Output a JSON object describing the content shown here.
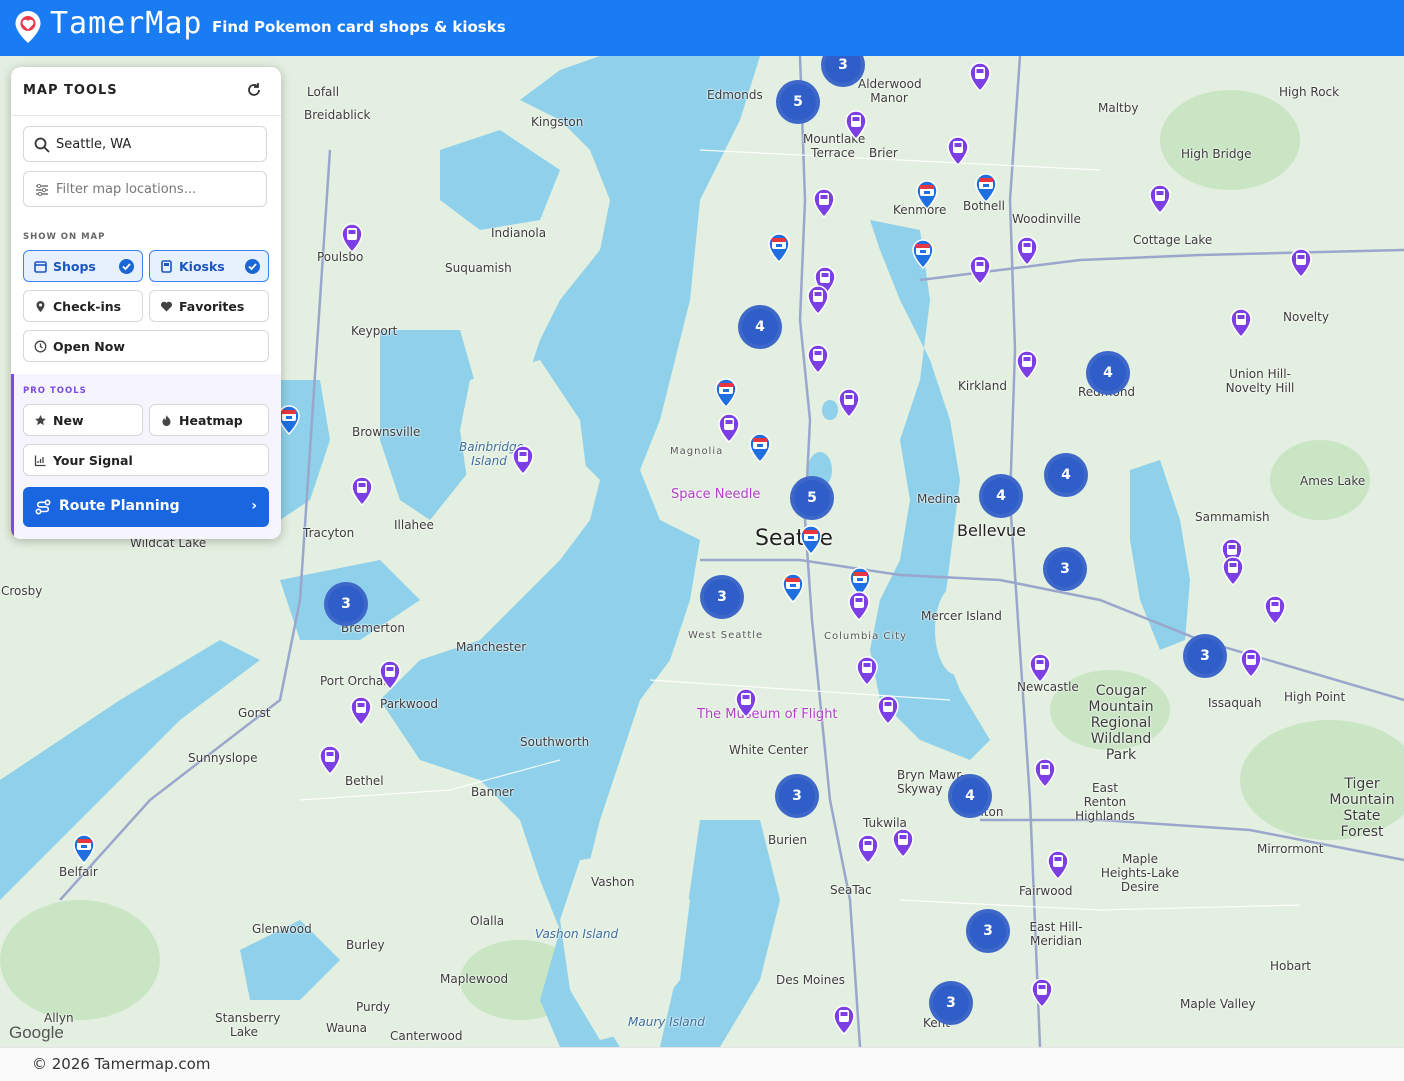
{
  "header": {
    "brand": "TamerMap",
    "tagline": "Find Pokemon card shops & kiosks"
  },
  "panel": {
    "title": "MAP TOOLS",
    "search": {
      "value": "Seattle, WA"
    },
    "filter": {
      "placeholder": "Filter map locations..."
    },
    "show_on_map_label": "SHOW ON MAP",
    "toggles": [
      {
        "label": "Shops",
        "active": true
      },
      {
        "label": "Kiosks",
        "active": true
      },
      {
        "label": "Check-ins",
        "active": false
      },
      {
        "label": "Favorites",
        "active": false
      },
      {
        "label": "Open Now",
        "active": false
      }
    ],
    "pro_tools_label": "PRO TOOLS",
    "pro_tools": [
      "New",
      "Heatmap",
      "Your Signal"
    ],
    "route_planning": "Route Planning"
  },
  "map": {
    "places": [
      {
        "t": "Lofall"
      },
      {
        "t": "Breidablick"
      },
      {
        "t": "Kingston"
      },
      {
        "t": "Edmonds"
      },
      {
        "t": "Alderwood Manor"
      },
      {
        "t": "Mountlake Terrace"
      },
      {
        "t": "Brier"
      },
      {
        "t": "Maltby"
      },
      {
        "t": "High Rock"
      },
      {
        "t": "High Bridge"
      },
      {
        "t": "Bothell"
      },
      {
        "t": "Kenmore"
      },
      {
        "t": "Woodinville"
      },
      {
        "t": "Cottage Lake"
      },
      {
        "t": "Indianola"
      },
      {
        "t": "Suquamish"
      },
      {
        "t": "Poulsbo"
      },
      {
        "t": "Keyport"
      },
      {
        "t": "Novelty"
      },
      {
        "t": "Kirkland"
      },
      {
        "t": "Redmond"
      },
      {
        "t": "Union Hill-Novelty Hill"
      },
      {
        "t": "Brownsville"
      },
      {
        "t": "Bainbridge Island"
      },
      {
        "t": "Magnolia"
      },
      {
        "t": "Space Needle"
      },
      {
        "t": "Seattle"
      },
      {
        "t": "Medina"
      },
      {
        "t": "Bellevue"
      },
      {
        "t": "Ames Lake"
      },
      {
        "t": "Sammamish"
      },
      {
        "t": "Tracyton"
      },
      {
        "t": "Illahee"
      },
      {
        "t": "Wildcat Lake"
      },
      {
        "t": "Crosby"
      },
      {
        "t": "Bremerton"
      },
      {
        "t": "Manchester"
      },
      {
        "t": "West Seattle"
      },
      {
        "t": "Columbia City"
      },
      {
        "t": "Mercer Island"
      },
      {
        "t": "Newcastle"
      },
      {
        "t": "Issaquah"
      },
      {
        "t": "High Point"
      },
      {
        "t": "Port Orchard"
      },
      {
        "t": "Parkwood"
      },
      {
        "t": "Gorst"
      },
      {
        "t": "Southworth"
      },
      {
        "t": "The Museum of Flight"
      },
      {
        "t": "White Center"
      },
      {
        "t": "Cougar Mountain Regional Wildland Park"
      },
      {
        "t": "Sunnyslope"
      },
      {
        "t": "Bethel"
      },
      {
        "t": "Banner"
      },
      {
        "t": "Bryn Mawr-Skyway"
      },
      {
        "t": "Renton"
      },
      {
        "t": "East Renton Highlands"
      },
      {
        "t": "Tiger Mountain State Forest"
      },
      {
        "t": "Belfair"
      },
      {
        "t": "Burien"
      },
      {
        "t": "Tukwila"
      },
      {
        "t": "Mirrormont"
      },
      {
        "t": "Vashon"
      },
      {
        "t": "SeaTac"
      },
      {
        "t": "Maple Heights-Lake Desire"
      },
      {
        "t": "Fairwood"
      },
      {
        "t": "Glenwood"
      },
      {
        "t": "Olalla"
      },
      {
        "t": "Vashon Island"
      },
      {
        "t": "Burley"
      },
      {
        "t": "East Hill-Meridian"
      },
      {
        "t": "Hobart"
      },
      {
        "t": "Maplewood"
      },
      {
        "t": "Des Moines"
      },
      {
        "t": "Purdy"
      },
      {
        "t": "Allyn"
      },
      {
        "t": "Stansberry Lake"
      },
      {
        "t": "Wauna"
      },
      {
        "t": "Canterwood"
      },
      {
        "t": "Maury Island"
      },
      {
        "t": "Kent"
      },
      {
        "t": "Maple Valley"
      }
    ],
    "clusters": [
      "3",
      "5",
      "4",
      "5",
      "4",
      "4",
      "4",
      "3",
      "3",
      "3",
      "3",
      "4",
      "3",
      "3",
      "3"
    ]
  },
  "footer": {
    "attribution": "Google",
    "copyright": "© 2026 Tamermap.com"
  }
}
